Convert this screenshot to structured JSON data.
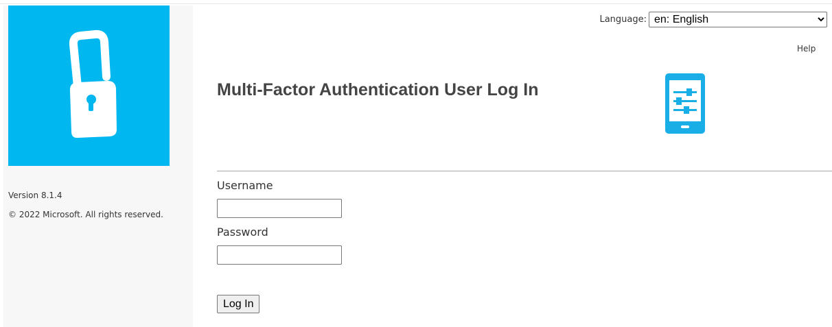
{
  "header": {
    "language_label": "Language:",
    "language_selected": "en: English",
    "help_label": "Help"
  },
  "sidebar": {
    "version": "Version 8.1.4",
    "copyright": "© 2022 Microsoft. All rights reserved."
  },
  "main": {
    "title": "Multi-Factor Authentication User Log In",
    "username_label": "Username",
    "username_value": "",
    "password_label": "Password",
    "password_value": "",
    "login_button": "Log In"
  },
  "colors": {
    "brand": "#00b7f0",
    "icon_blue": "#1aaee6"
  },
  "icons": {
    "brand_logo": "phone-padlock-icon",
    "title_icon": "phone-settings-icon"
  }
}
